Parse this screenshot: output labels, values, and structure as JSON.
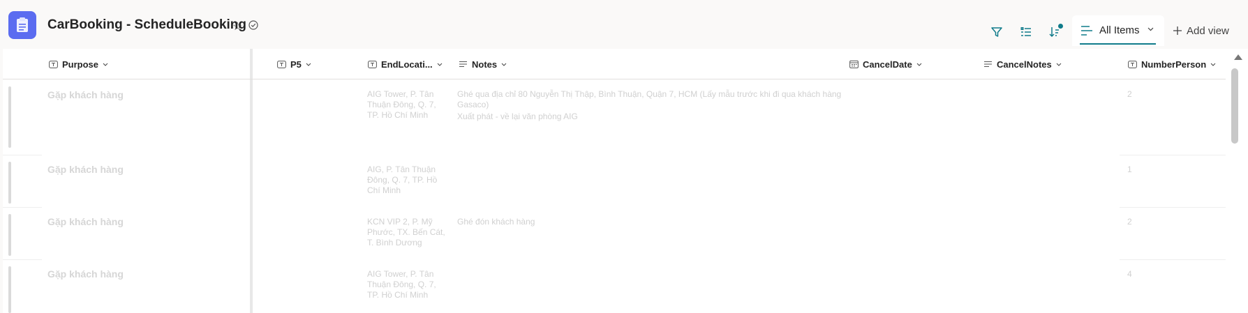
{
  "header": {
    "title": "CarBooking - ScheduleBooking",
    "view_label": "All Items",
    "add_view_label": "Add view"
  },
  "icons": {
    "app": "clipboard-icon",
    "favorite": "star-icon",
    "status": "check-circle-icon",
    "filter": "filter-icon",
    "group": "list-settings-icon",
    "sort": "sort-icon",
    "view": "view-list-icon",
    "add": "plus-icon",
    "chevron": "chevron-down-icon"
  },
  "colors": {
    "accent": "#0f7b8a",
    "app_icon": "#5b6cf0"
  },
  "columns": [
    {
      "label": "Purpose",
      "icon": "text-icon"
    },
    {
      "label": "P5",
      "icon": "text-icon"
    },
    {
      "label": "EndLocati...",
      "icon": "text-icon"
    },
    {
      "label": "Notes",
      "icon": "multiline-icon"
    },
    {
      "label": "CancelDate",
      "icon": "calendar-icon"
    },
    {
      "label": "CancelNotes",
      "icon": "multiline-icon"
    },
    {
      "label": "NumberPerson",
      "icon": "text-icon"
    }
  ],
  "rows": [
    {
      "purpose": "Gặp khách hàng",
      "end_location": "AIG Tower, P. Tân Thuận Đông, Q. 7, TP. Hồ Chí Minh",
      "notes": "Ghé qua địa chỉ 80 Nguyễn Thị Thập, Bình Thuận, Quận 7, HCM (Lấy mẫu trước khi đi qua khách hàng Gasaco)",
      "notes_line2": "Xuất phát - về lại văn phòng AIG",
      "number_person": "2"
    },
    {
      "purpose": "Gặp khách hàng",
      "end_location": "AIG, P. Tân Thuận Đông, Q. 7, TP. Hồ Chí Minh",
      "notes": "",
      "notes_line2": "",
      "number_person": "1"
    },
    {
      "purpose": "Gặp khách hàng",
      "end_location": "KCN VIP 2, P. Mỹ Phước, TX. Bến Cát, T. Bình Dương",
      "notes": "Ghé đón khách hàng",
      "notes_line2": "",
      "number_person": "2"
    },
    {
      "purpose": "Gặp khách hàng",
      "end_location": "AIG Tower, P. Tân Thuận Đông, Q. 7, TP. Hồ Chí Minh",
      "notes": "",
      "notes_line2": "",
      "number_person": "4"
    }
  ]
}
